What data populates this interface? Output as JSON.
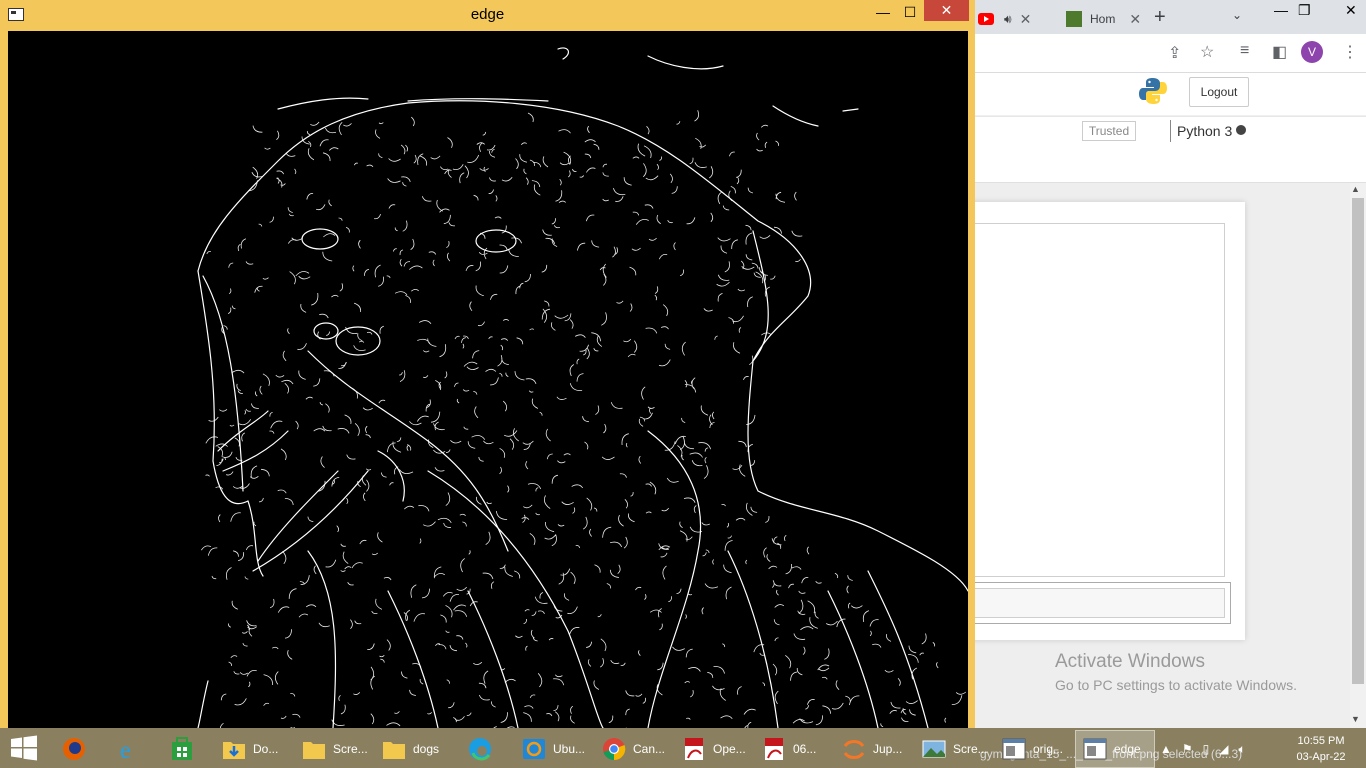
{
  "browser": {
    "tabs": [
      {
        "label": "",
        "icon": "youtube-icon",
        "audio_icon": "speaker-icon"
      },
      {
        "label": "Hom",
        "icon": "jupyterhub-icon"
      }
    ],
    "profile_initial": "V",
    "toolbar_icons": [
      "share-icon",
      "bookmark-star-icon",
      "reading-list-icon",
      "side-panel-icon"
    ]
  },
  "jupyter": {
    "logout_label": "Logout",
    "trusted_label": "Trusted",
    "kernel_label": "Python 3"
  },
  "activation": {
    "title": "Activate Windows",
    "subtitle": "Go to PC settings to activate Windows."
  },
  "edge_window": {
    "title": "edge",
    "close_symbol": "✕",
    "minimize_symbol": "—",
    "maximize_symbol": "☐"
  },
  "taskbar": {
    "items": [
      {
        "label": "",
        "icon": "firefox-icon"
      },
      {
        "label": "",
        "icon": "internet-explorer-icon"
      },
      {
        "label": "",
        "icon": "store-icon"
      },
      {
        "label": "Do...",
        "icon": "downloads-folder-icon"
      },
      {
        "label": "Scre...",
        "icon": "folder-icon"
      },
      {
        "label": "dogs",
        "icon": "folder-icon"
      },
      {
        "label": "",
        "icon": "edge-browser-icon"
      },
      {
        "label": "Ubu...",
        "icon": "ubuntu-terminal-icon"
      },
      {
        "label": "Can...",
        "icon": "chrome-icon"
      },
      {
        "label": "Ope...",
        "icon": "pdf-icon"
      },
      {
        "label": "06...",
        "icon": "pdf-icon"
      },
      {
        "label": "Jup...",
        "icon": "jupyter-icon"
      },
      {
        "label": "Scre...",
        "icon": "image-viewer-icon"
      },
      {
        "label": "orig...",
        "icon": "opencv-window-icon"
      },
      {
        "label": "edge",
        "icon": "opencv-window-icon"
      }
    ],
    "clock_time": "10:55 PM",
    "clock_date": "03-Apr-22",
    "background_status_text": "gymagenta_15_..._hind_front.png  selected (6...3)"
  },
  "colors": {
    "title_bar": "#f4c75a",
    "close_button": "#c7473a",
    "taskbar": "#8a8060",
    "canvas": "#000000"
  }
}
